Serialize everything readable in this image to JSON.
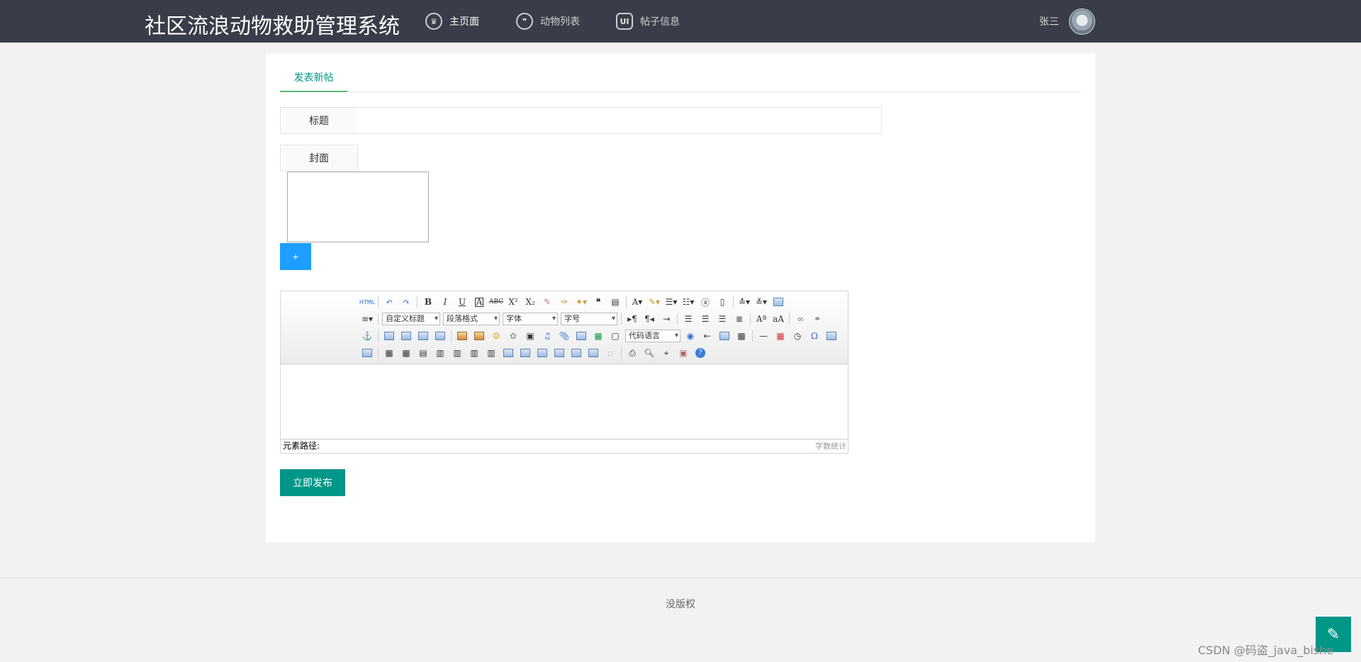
{
  "header": {
    "brand": "社区流浪动物救助管理系统",
    "nav": [
      {
        "label": "主页面",
        "icon": "crown-icon"
      },
      {
        "label": "动物列表",
        "icon": "chat-icon"
      },
      {
        "label": "帖子信息",
        "icon": "ui-icon"
      }
    ],
    "user_name": "张三"
  },
  "tabs": {
    "active": "发表新帖"
  },
  "form": {
    "title_label": "标题",
    "title_value": "",
    "cover_label": "封面",
    "add_button": "+",
    "publish_button": "立即发布"
  },
  "editor": {
    "html_button": "HTML",
    "combo_heading": "自定义标题",
    "combo_paragraph": "段落格式",
    "combo_font": "字体",
    "combo_size": "字号",
    "combo_code": "代码语言",
    "path_label": "元素路径:",
    "word_count": "字数统计"
  },
  "footer": {
    "text": "没版权"
  },
  "watermark": "CSDN @码盗_java_bishe",
  "colors": {
    "header_bg": "#393d49",
    "accent": "#009688",
    "blue": "#1e9fff"
  }
}
